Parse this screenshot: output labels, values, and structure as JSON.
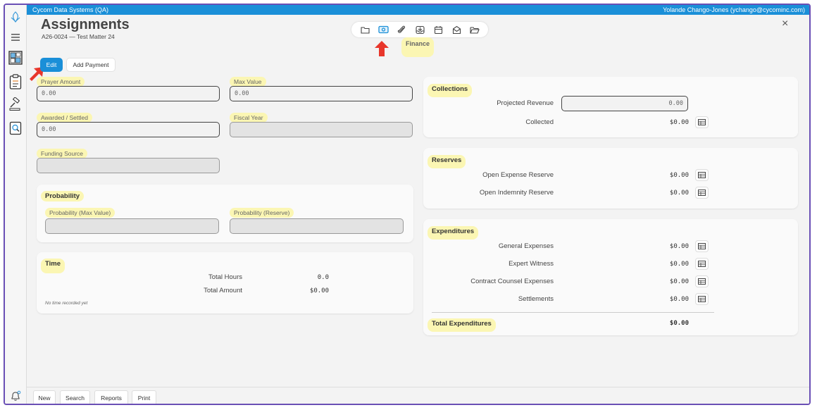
{
  "topbar": {
    "org": "Cycom Data Systems (QA)",
    "user": "Yolande Chango-Jones (ychango@cycominc.com)"
  },
  "header": {
    "title": "Assignments",
    "subtitle": "A26-0024 — Test Matter 24",
    "close": "×"
  },
  "toolbar": {
    "active_label": "Finance",
    "active_color": "#1a8fd8"
  },
  "actions": {
    "edit": "Edit",
    "add_payment": "Add Payment"
  },
  "form": {
    "prayer_amount": {
      "label": "Prayer Amount",
      "value": "0.00"
    },
    "max_value": {
      "label": "Max Value",
      "value": "0.00"
    },
    "awarded": {
      "label": "Awarded / Settled",
      "value": "0.00"
    },
    "fiscal_year": {
      "label": "Fiscal Year",
      "value": ""
    },
    "funding_source": {
      "label": "Funding Source",
      "value": ""
    }
  },
  "probability": {
    "title": "Probability",
    "max_label": "Probability (Max Value)",
    "reserve_label": "Probability (Reserve)"
  },
  "time": {
    "title": "Time",
    "hours_label": "Total Hours",
    "hours_value": "0.0",
    "amount_label": "Total Amount",
    "amount_value": "$0.00",
    "note": "No time recorded yet"
  },
  "collections": {
    "title": "Collections",
    "projected_label": "Projected Revenue",
    "projected_value": "0.00",
    "collected_label": "Collected",
    "collected_value": "$0.00"
  },
  "reserves": {
    "title": "Reserves",
    "rows": [
      {
        "label": "Open Expense Reserve",
        "value": "$0.00"
      },
      {
        "label": "Open Indemnity Reserve",
        "value": "$0.00"
      }
    ]
  },
  "expenditures": {
    "title": "Expenditures",
    "rows": [
      {
        "label": "General Expenses",
        "value": "$0.00"
      },
      {
        "label": "Expert Witness",
        "value": "$0.00"
      },
      {
        "label": "Contract Counsel Expenses",
        "value": "$0.00"
      },
      {
        "label": "Settlements",
        "value": "$0.00"
      }
    ],
    "total_label": "Total Expenditures",
    "total_value": "$0.00"
  },
  "bottombar": {
    "new": "New",
    "search": "Search",
    "reports": "Reports",
    "print": "Print"
  },
  "colors": {
    "accent": "#1a8fd8",
    "highlight": "#fbf6b3",
    "arrow": "#e8362b",
    "frame": "#6a4fb5"
  }
}
